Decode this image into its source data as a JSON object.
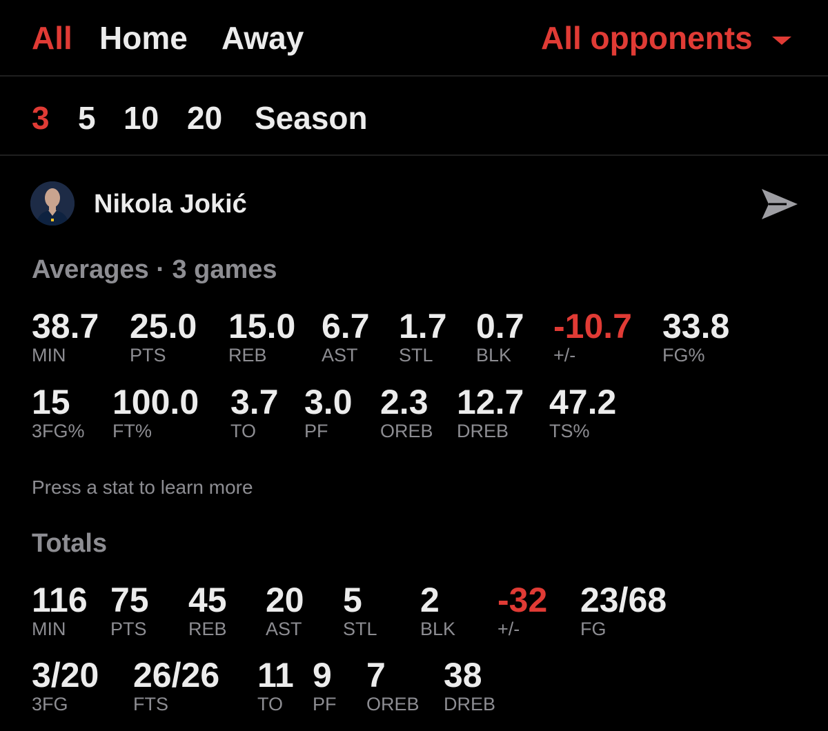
{
  "filters": {
    "location_tabs": [
      "All",
      "Home",
      "Away"
    ],
    "opponents": "All opponents",
    "ranges": [
      "3",
      "5",
      "10",
      "20",
      "Season"
    ]
  },
  "player": {
    "name": "Nikola Jokić"
  },
  "averages": {
    "title": "Averages · 3 games",
    "row1": [
      {
        "value": "38.7",
        "label": "MIN"
      },
      {
        "value": "25.0",
        "label": "PTS"
      },
      {
        "value": "15.0",
        "label": "REB"
      },
      {
        "value": "6.7",
        "label": "AST"
      },
      {
        "value": "1.7",
        "label": "STL"
      },
      {
        "value": "0.7",
        "label": "BLK"
      },
      {
        "value": "-10.7",
        "label": "+/-"
      },
      {
        "value": "33.8",
        "label": "FG%"
      }
    ],
    "row2": [
      {
        "value": "15",
        "label": "3FG%"
      },
      {
        "value": "100.0",
        "label": "FT%"
      },
      {
        "value": "3.7",
        "label": "TO"
      },
      {
        "value": "3.0",
        "label": "PF"
      },
      {
        "value": "2.3",
        "label": "OREB"
      },
      {
        "value": "12.7",
        "label": "DREB"
      },
      {
        "value": "47.2",
        "label": "TS%"
      }
    ]
  },
  "hint": "Press a stat to learn more",
  "totals": {
    "title": "Totals",
    "row1": [
      {
        "value": "116",
        "label": "MIN"
      },
      {
        "value": "75",
        "label": "PTS"
      },
      {
        "value": "45",
        "label": "REB"
      },
      {
        "value": "20",
        "label": "AST"
      },
      {
        "value": "5",
        "label": "STL"
      },
      {
        "value": "2",
        "label": "BLK"
      },
      {
        "value": "-32",
        "label": "+/-"
      },
      {
        "value": "23/68",
        "label": "FG"
      }
    ],
    "row2": [
      {
        "value": "3/20",
        "label": "3FG"
      },
      {
        "value": "26/26",
        "label": "FTS"
      },
      {
        "value": "11",
        "label": "TO"
      },
      {
        "value": "9",
        "label": "PF"
      },
      {
        "value": "7",
        "label": "OREB"
      },
      {
        "value": "38",
        "label": "DREB"
      }
    ]
  },
  "colors": {
    "accent": "#e03b35",
    "background": "#000000",
    "text": "#ececec",
    "muted": "#8d8d92"
  },
  "icons": {
    "share": "send-icon",
    "dropdown": "chevron-down-icon"
  }
}
